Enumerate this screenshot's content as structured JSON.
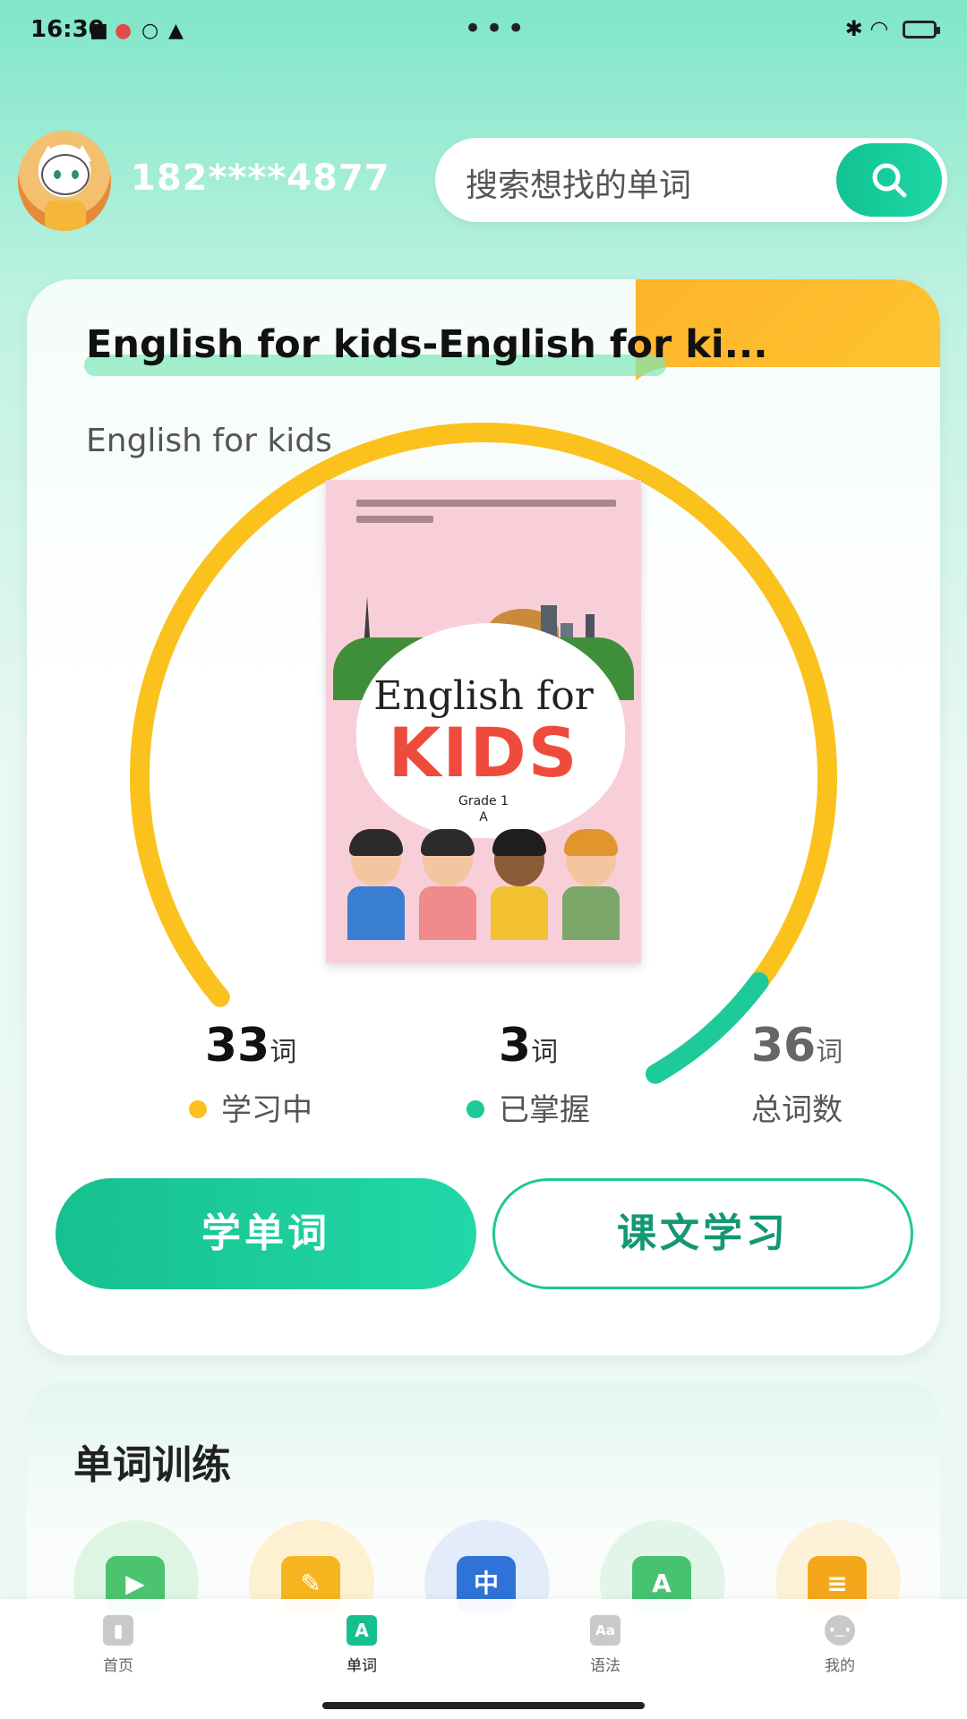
{
  "status_bar": {
    "time": "16:30",
    "menu": "•••"
  },
  "header": {
    "phone": "182****4877",
    "search_placeholder": "搜索想找的单词",
    "search_icon": "search-icon"
  },
  "book": {
    "title": "English for kids-English for ki...",
    "subtitle": "English for kids",
    "cover": {
      "line1": "English for",
      "line2": "KIDS",
      "grade": "Grade 1",
      "volume": "A"
    }
  },
  "progress": {
    "learning_fraction": 0.917,
    "learning_color": "#fbc21e",
    "mastered_color": "#1ec99a"
  },
  "stats": [
    {
      "value": "33",
      "unit": "词",
      "label": "学习中",
      "dot": "#fbc21e"
    },
    {
      "value": "3",
      "unit": "词",
      "label": "已掌握",
      "dot": "#1ec99a"
    },
    {
      "value": "36",
      "unit": "词",
      "label": "总词数"
    }
  ],
  "buttons": {
    "learn_words": "学单词",
    "text_study": "课文学习"
  },
  "training": {
    "title": "单词训练",
    "items": [
      {
        "icon": "tv-play-icon",
        "glyph": "▶"
      },
      {
        "icon": "clipboard-icon",
        "glyph": "✎"
      },
      {
        "icon": "translate-icon",
        "glyph": "中"
      },
      {
        "icon": "letter-a-icon",
        "glyph": "A"
      },
      {
        "icon": "document-icon",
        "glyph": "≡"
      }
    ]
  },
  "tabs": [
    {
      "label": "首页",
      "icon": "home-icon",
      "glyph": "▮"
    },
    {
      "label": "单词",
      "icon": "word-icon",
      "glyph": "A",
      "active": true
    },
    {
      "label": "语法",
      "icon": "grammar-icon",
      "glyph": "Aa"
    },
    {
      "label": "我的",
      "icon": "profile-icon",
      "glyph": "•‿•"
    }
  ]
}
